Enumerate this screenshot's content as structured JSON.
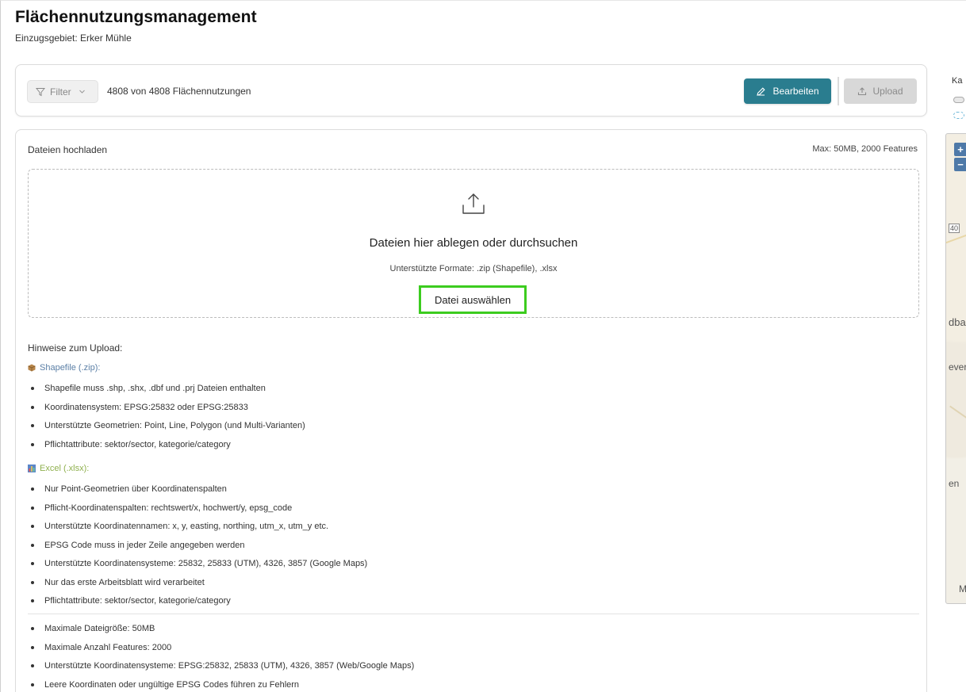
{
  "header": {
    "title": "Flächennutzungsmanagement",
    "subtitle": "Einzugsgebiet: Erker Mühle"
  },
  "toolbar": {
    "filter_label": "Filter",
    "count_text": "4808 von 4808 Flächennutzungen",
    "edit_label": "Bearbeiten",
    "upload_label": "Upload"
  },
  "upload": {
    "title": "Dateien hochladen",
    "limit": "Max: 50MB, 2000 Features",
    "dropzone_title": "Dateien hier ablegen oder durchsuchen",
    "dropzone_formats": "Unterstützte Formate: .zip (Shapefile), .xlsx",
    "select_label": "Datei auswählen"
  },
  "notes": {
    "heading": "Hinweise zum Upload:",
    "shapefile": {
      "title": "Shapefile (.zip):",
      "items": [
        "Shapefile muss .shp, .shx, .dbf und .prj Dateien enthalten",
        "Koordinatensystem: EPSG:25832 oder EPSG:25833",
        "Unterstützte Geometrien: Point, Line, Polygon (und Multi-Varianten)",
        "Pflichtattribute: sektor/sector, kategorie/category"
      ]
    },
    "excel": {
      "title": "Excel (.xlsx):",
      "items": [
        "Nur Point-Geometrien über Koordinatenspalten",
        "Pflicht-Koordinatenspalten: rechtswert/x, hochwert/y, epsg_code",
        "Unterstützte Koordinatennamen: x, y, easting, northing, utm_x, utm_y etc.",
        "EPSG Code muss in jeder Zeile angegeben werden",
        "Unterstützte Koordinatensysteme: 25832, 25833 (UTM), 4326, 3857 (Google Maps)",
        "Nur das erste Arbeitsblatt wird verarbeitet",
        "Pflichtattribute: sektor/sector, kategorie/category"
      ]
    },
    "general": [
      "Maximale Dateigröße: 50MB",
      "Maximale Anzahl Features: 2000",
      "Unterstützte Koordinatensysteme: EPSG:25832, 25833 (UTM), 4326, 3857 (Web/Google Maps)",
      "Leere Koordinaten oder ungültige EPSG Codes führen zu Fehlern"
    ]
  },
  "map": {
    "label": "Ka",
    "zoom_in": "+",
    "zoom_out": "−",
    "labels": [
      "40",
      "dba",
      "ever",
      "en",
      "M"
    ]
  },
  "colors": {
    "primary": "#2a7d8f",
    "highlight": "#3ccc1f",
    "shapefile_accent": "#5b7fa6",
    "excel_accent": "#8fb04e"
  }
}
